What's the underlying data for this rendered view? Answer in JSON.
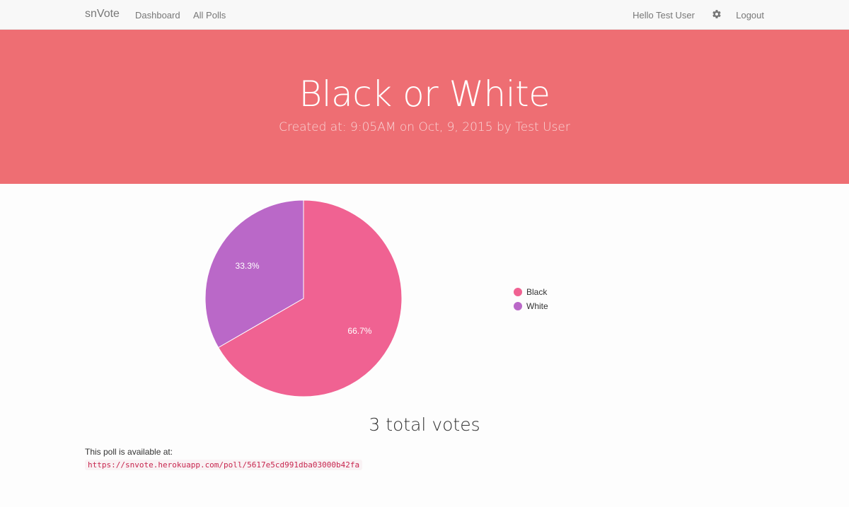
{
  "nav": {
    "brand": "snVote",
    "links": [
      "Dashboard",
      "All Polls"
    ],
    "greeting": "Hello Test User",
    "settings_icon": "gear-icon",
    "logout": "Logout"
  },
  "hero": {
    "title": "Black or White",
    "subtitle": "Created at: 9:05AM on Oct, 9, 2015 by Test User",
    "background": "#ee6e73"
  },
  "chart_data": {
    "type": "pie",
    "categories": [
      "Black",
      "White"
    ],
    "values": [
      2,
      1
    ],
    "labels": [
      "66.7%",
      "33.3%"
    ],
    "colors": [
      "#f06292",
      "#ba68c8"
    ],
    "legend_position": "right"
  },
  "summary": {
    "total_votes": "3 total votes",
    "available_label": "This poll is available at:",
    "poll_url": "https://snvote.herokuapp.com/poll/5617e5cd991dba03000b42fa"
  }
}
